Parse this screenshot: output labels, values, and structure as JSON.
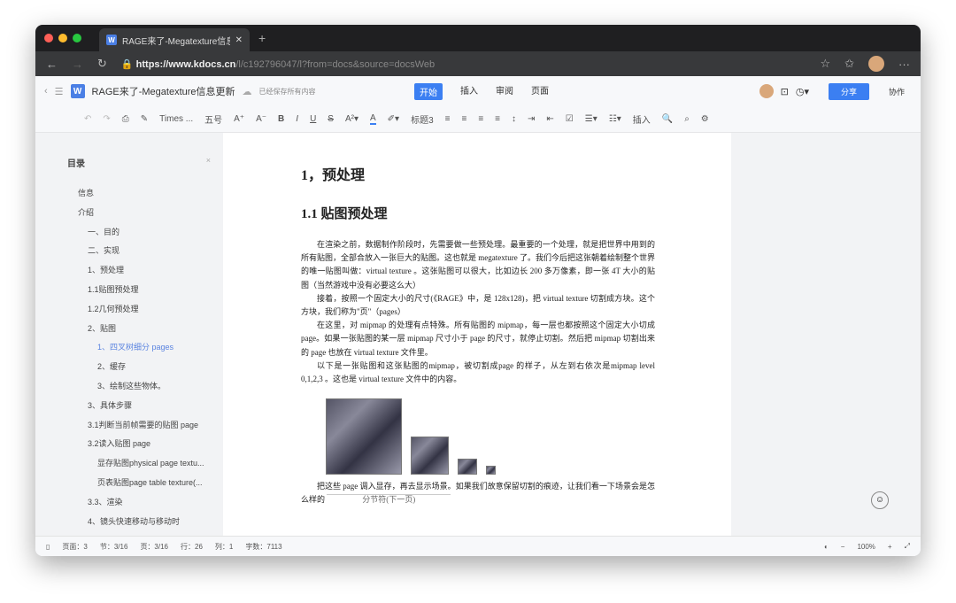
{
  "browser": {
    "tab_title": "RAGE来了-Megatexture信息更",
    "url_host": "https://www.kdocs.cn",
    "url_path": "/l/c192796047/l?from=docs&source=docsWeb"
  },
  "app": {
    "doc_title": "RAGE来了-Megatexture信息更新",
    "save_status": "已经保存所有内容",
    "menu": [
      "开始",
      "插入",
      "审阅",
      "页面"
    ],
    "share_label": "分享",
    "collab_label": "协作"
  },
  "toolbar": {
    "font_name": "Times ...",
    "font_size": "五号",
    "style": "标题3",
    "insert": "插入"
  },
  "toc": {
    "title": "目录",
    "items": [
      "信息",
      "介绍",
      "一、目的",
      "二、实现",
      "1、预处理",
      "1.1贴图预处理",
      "1.2几何预处理",
      "2、贴图",
      "1、四叉树细分 pages",
      "2、缓存",
      "3、绘制这些物体。",
      "3、具体步骤",
      "3.1判断当前帧需要的贴图 page",
      "3.2读入贴图 page",
      "显存贴图physical page textu...",
      "页表贴图page table texture(...",
      "3.3、渲染",
      "4、镜头快速移动与移动时"
    ],
    "active_index": 8
  },
  "doc": {
    "h1": "1，预处理",
    "h2": "1.1 贴图预处理",
    "paragraphs": [
      "在渲染之前，数据制作阶段时，先需要做一些预处理。最重要的一个处理，就是把世界中用到的所有贴图，全部合放入一张巨大的贴图。这也就是 megatexture 了。我们今后把这张朝着绘制整个世界的唯一贴图叫做：virtual texture 。这张贴图可以很大，比如边长 200 多万像素，即一张 4T 大小的贴图（当然游戏中没有必要这么大）",
      "接着，按照一个固定大小的尺寸(《RAGE》中，是 128x128)，把 virtual texture 切割成方块。这个方块，我们称为\"页\"（pages）",
      "在这里，对 mipmap 的处理有点特殊。所有贴图的 mipmap，每一层也都按照这个固定大小切成 page。如果一张贴图的某一层 mipmap 尺寸小于 page 的尺寸，就停止切割。然后把 mipmap 切割出来的 page 也放在 virtual texture 文件里。",
      "以下是一张贴图和这张贴图的mipmap，被切割成page 的样子，从左到右依次是mipmap level 0,1,2,3 。这也是 virtual texture 文件中的内容。",
      "把这些 page 调入显存，再去显示场景。如果我们故意保留切割的痕迹，让我们看一下场景会是怎么样的"
    ],
    "footer_note": "分节符(下一页)"
  },
  "status": {
    "pages": "页面：3",
    "sections": "节：3/16",
    "page_pos": "页：3/16",
    "row": "行：26",
    "col": "列：1",
    "words": "字数：7113",
    "zoom": "100%"
  }
}
